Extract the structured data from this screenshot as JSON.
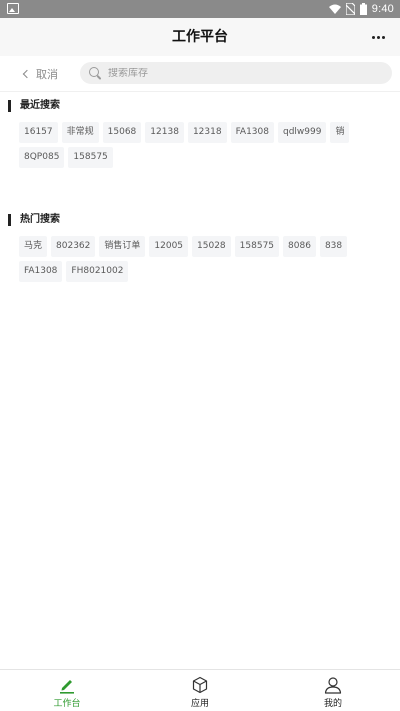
{
  "status_bar": {
    "time": "9:40"
  },
  "header": {
    "title": "工作平台"
  },
  "search": {
    "cancel_label": "取消",
    "placeholder": "搜索库存"
  },
  "recent": {
    "title": "最近搜索",
    "tags": [
      "16157",
      "非常规",
      "15068",
      "12138",
      "12318",
      "FA1308",
      "qdlw999",
      "销",
      "8QP085",
      "158575"
    ]
  },
  "hot": {
    "title": "热门搜索",
    "tags": [
      "马克",
      "802362",
      "销售订单",
      "12005",
      "15028",
      "158575",
      "8086",
      "838",
      "FA1308",
      "FH8021002"
    ]
  },
  "tabbar": {
    "items": [
      {
        "label": "工作台",
        "icon": "pencil-icon",
        "active": true
      },
      {
        "label": "应用",
        "icon": "cube-icon",
        "active": false
      },
      {
        "label": "我的",
        "icon": "user-icon",
        "active": false
      }
    ]
  },
  "colors": {
    "accent": "#2f9a2f",
    "status_bar": "#8a8a8a",
    "tag_bg": "#f4f5f7"
  }
}
